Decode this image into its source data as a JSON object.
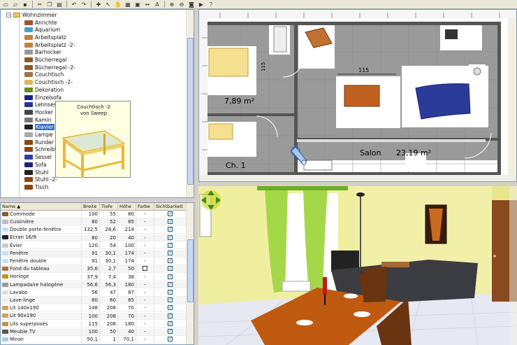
{
  "toolbar": {
    "icons": [
      "new-file-icon",
      "open-icon",
      "save-icon",
      "cut-icon",
      "copy-icon",
      "paste-icon",
      "undo-icon",
      "redo-icon",
      "add-furniture-icon",
      "select-icon",
      "pan-icon",
      "create-walls-icon",
      "create-rooms-icon",
      "create-dimensions-icon",
      "add-text-icon",
      "zoom-in-icon",
      "zoom-out-icon",
      "create-photo-icon",
      "create-video-icon",
      "help-icon"
    ]
  },
  "catalog": {
    "root_label": "Wohnzimmer",
    "items": [
      {
        "label": "Anrichte",
        "color": "#a0522d"
      },
      {
        "label": "Aquarium",
        "color": "#4aa0c0"
      },
      {
        "label": "Arbeitsplatz",
        "color": "#c08040"
      },
      {
        "label": "Arbeitsplatz -2-",
        "color": "#c08040"
      },
      {
        "label": "Barhocker",
        "color": "#999999"
      },
      {
        "label": "Bücherregal",
        "color": "#8b5a2b"
      },
      {
        "label": "Bücherregal -2-",
        "color": "#8b5a2b"
      },
      {
        "label": "Couchtisch",
        "color": "#a87040"
      },
      {
        "label": "Couchtisch -2-",
        "color": "#d8b860"
      },
      {
        "label": "Dekoration",
        "color": "#6b8e23"
      },
      {
        "label": "Einzelsofa",
        "color": "#1a237e"
      },
      {
        "label": "Lehnsessel",
        "color": "#283593"
      },
      {
        "label": "Hocker",
        "color": "#444444"
      },
      {
        "label": "Kamin",
        "color": "#777777"
      },
      {
        "label": "Klavier",
        "color": "#222222"
      },
      {
        "label": "Lampe",
        "color": "#aaaaaa"
      },
      {
        "label": "Runder Tisch",
        "color": "#8b4513"
      },
      {
        "label": "Schreibtisch",
        "color": "#8b4513"
      },
      {
        "label": "Sessel",
        "color": "#303f9f"
      },
      {
        "label": "Sofa",
        "color": "#1a237e"
      },
      {
        "label": "Stuhl",
        "color": "#222222"
      },
      {
        "label": "Stuhl -2-",
        "color": "#8b4513"
      },
      {
        "label": "Tisch",
        "color": "#8b4513"
      }
    ],
    "selected_index": 14,
    "tooltip": {
      "title_line1": "Couchtisch -2",
      "title_line2": "von Sweep"
    }
  },
  "furniture_table": {
    "headers": [
      "Name ▲",
      "Breite",
      "Tiefe",
      "Höhe",
      "Farbe",
      "Sichtbarkeit"
    ],
    "rows": [
      {
        "name": "Commode",
        "w": "100",
        "d": "55",
        "h": "80",
        "color": "-",
        "visible": true,
        "icon": "#8b5a2b"
      },
      {
        "name": "Cuisinière",
        "w": "60",
        "d": "52",
        "h": "85",
        "color": "-",
        "visible": true,
        "icon": "#bbbbbb"
      },
      {
        "name": "Double porte-fenêtre",
        "w": "132,5",
        "d": "28,6",
        "h": "214",
        "color": "-",
        "visible": true,
        "icon": "#c8e0f0"
      },
      {
        "name": "Écran 16/9",
        "w": "60",
        "d": "20",
        "h": "40",
        "color": "-",
        "visible": true,
        "icon": "#222222"
      },
      {
        "name": "Évier",
        "w": "120",
        "d": "54",
        "h": "100",
        "color": "-",
        "visible": true,
        "icon": "#cccccc"
      },
      {
        "name": "Fenêtre",
        "w": "91",
        "d": "30,1",
        "h": "174",
        "color": "-",
        "visible": true,
        "icon": "#c8e0f0"
      },
      {
        "name": "Fenêtre double",
        "w": "91",
        "d": "30,1",
        "h": "174",
        "color": "-",
        "visible": true,
        "icon": "#c8e0f0"
      },
      {
        "name": "Fond du tableau",
        "w": "35,6",
        "d": "2,7",
        "h": "50",
        "color": "□",
        "visible": true,
        "icon": "#b07030"
      },
      {
        "name": "Horloge",
        "w": "37,9",
        "d": "7,4",
        "h": "38",
        "color": "-",
        "visible": true,
        "icon": "#c89020"
      },
      {
        "name": "Lampadaire halogène",
        "w": "56,6",
        "d": "56,3",
        "h": "180",
        "color": "-",
        "visible": true,
        "icon": "#999999"
      },
      {
        "name": "Lavabo",
        "w": "56",
        "d": "47",
        "h": "87",
        "color": "-",
        "visible": true,
        "icon": "#dddddd"
      },
      {
        "name": "Lave-linge",
        "w": "60",
        "d": "60",
        "h": "85",
        "color": "-",
        "visible": true,
        "icon": "#eeeeee"
      },
      {
        "name": "Lit 140x190",
        "w": "148",
        "d": "208",
        "h": "70",
        "color": "-",
        "visible": true,
        "icon": "#d0a060"
      },
      {
        "name": "Lit 90x190",
        "w": "100",
        "d": "208",
        "h": "70",
        "color": "-",
        "visible": true,
        "icon": "#d0a060"
      },
      {
        "name": "Lits superposés",
        "w": "115",
        "d": "208",
        "h": "180",
        "color": "-",
        "visible": true,
        "icon": "#c09050"
      },
      {
        "name": "Meuble TV",
        "w": "100",
        "d": "50",
        "h": "40",
        "color": "-",
        "visible": true,
        "icon": "#555555"
      },
      {
        "name": "Miroir",
        "w": "50,1",
        "d": "1",
        "h": "70,1",
        "color": "-",
        "visible": true,
        "icon": "#aaccdd"
      }
    ]
  },
  "plan": {
    "room_small_area": "7,89 m²",
    "room_living_label": "Salon",
    "room_living_area": "23,19 m²",
    "room_bed_label": "Ch. 1",
    "dimension_label": "115",
    "vertical_dim_label": "115"
  },
  "colors": {
    "plan_floor": "#999999",
    "wall_dark": "#555555",
    "sofa": "#1a237e",
    "wall_yellow": "#f0efa0",
    "curtain": "#9ad040",
    "floor_tile": "#e8eaf2",
    "table_wood": "#c05a10",
    "selection_blue": "#316ac5"
  }
}
